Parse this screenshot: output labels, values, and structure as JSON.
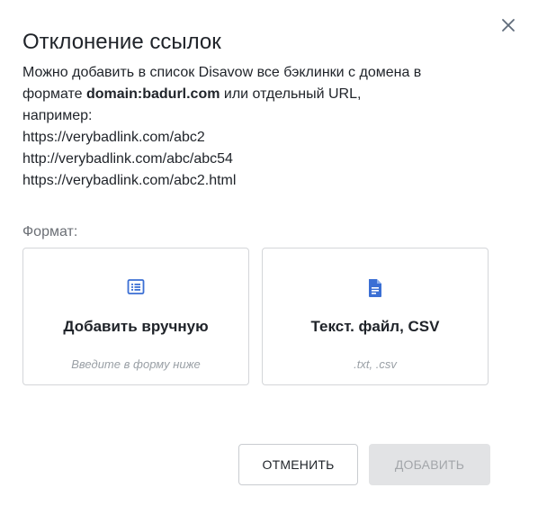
{
  "dialog": {
    "title": "Отклонение ссылок",
    "desc": {
      "line1": "Можно добавить в список Disavow все бэклинки с домена в",
      "line2_before": "формате ",
      "line2_bold": "domain:badurl.com",
      "line2_after": " или отдельный URL,",
      "line3": "например:",
      "example1": "https://verybadlink.com/abc2",
      "example2": "http://verybadlink.com/abc/abc54",
      "example3": "https://verybadlink.com/abc2.html"
    },
    "format_label": "Формат:",
    "options": [
      {
        "icon": "list-icon",
        "title": "Добавить вручную",
        "hint": "Введите в форму ниже"
      },
      {
        "icon": "file-icon",
        "title": "Текст. файл, CSV",
        "hint": ".txt, .csv"
      }
    ],
    "buttons": {
      "cancel": "ОТМЕНИТЬ",
      "add": "ДОБАВИТЬ"
    }
  },
  "colors": {
    "accent": "#3b6fd4",
    "disabled_bg": "#e2e3e5",
    "disabled_text": "#a3a6aa",
    "border": "#d4d6d9"
  }
}
